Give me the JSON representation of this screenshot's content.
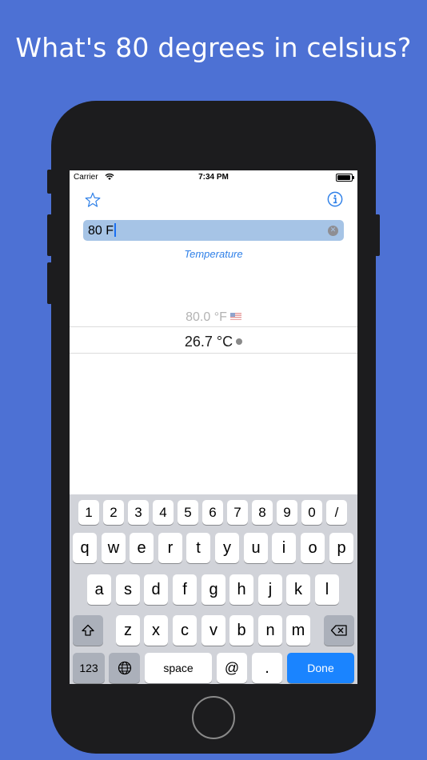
{
  "headline": "What's 80 degrees in celsius?",
  "status_bar": {
    "carrier": "Carrier",
    "time": "7:34 PM"
  },
  "search": {
    "value": "80 F"
  },
  "category": "Temperature",
  "results": {
    "source": "80.0 °F",
    "target": "26.7 °C"
  },
  "colors": {
    "background": "#4d71d4",
    "accent": "#2f80e8",
    "search_field": "#a6c4e6",
    "done_key": "#1a84ff"
  },
  "keyboard": {
    "numbers": [
      "1",
      "2",
      "3",
      "4",
      "5",
      "6",
      "7",
      "8",
      "9",
      "0",
      "/"
    ],
    "row1": [
      "q",
      "w",
      "e",
      "r",
      "t",
      "y",
      "u",
      "i",
      "o",
      "p"
    ],
    "row2": [
      "a",
      "s",
      "d",
      "f",
      "g",
      "h",
      "j",
      "k",
      "l"
    ],
    "row3": [
      "z",
      "x",
      "c",
      "v",
      "b",
      "n",
      "m"
    ],
    "bottom": {
      "numbers": "123",
      "space": "space",
      "at": "@",
      "period": ".",
      "done": "Done"
    },
    "icons": {
      "shift": "shift-icon",
      "delete": "backspace-icon",
      "globe": "globe-icon"
    }
  }
}
